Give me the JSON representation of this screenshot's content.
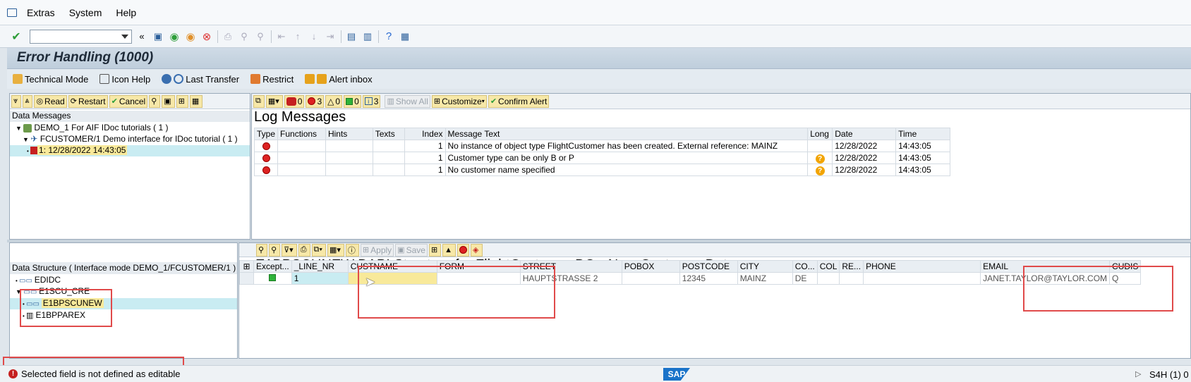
{
  "menu": {
    "items": [
      "Extras",
      "System",
      "Help"
    ]
  },
  "title": "Error Handling (1000)",
  "app_toolbar": [
    "Technical Mode",
    "Icon Help",
    "Last Transfer",
    "Restrict",
    "Alert inbox"
  ],
  "left_pane": {
    "buttons": [
      "Read",
      "Restart",
      "Cancel"
    ],
    "section_title": "Data Messages",
    "tree": [
      "DEMO_1 For AIF IDoc tutorials ( 1 )",
      "FCUSTOMER/1 Demo interface for IDoc tutorial ( 1 )",
      "1: 12/28/2022 14:43:05"
    ]
  },
  "log": {
    "counts": {
      "stop": "0",
      "error": "3",
      "warning": "0",
      "success": "0",
      "info": "3"
    },
    "buttons": [
      "Show All",
      "Customize",
      "Confirm Alert"
    ],
    "title": "Log Messages",
    "columns": [
      "Type",
      "Functions",
      "Hints",
      "Texts",
      "Index",
      "Message Text",
      "Long",
      "Date",
      "Time"
    ],
    "rows": [
      {
        "index": "1",
        "text": "No instance of object type FlightCustomer has been created. External reference: MAINZ",
        "long": "",
        "date": "12/28/2022",
        "time": "14:43:05"
      },
      {
        "index": "1",
        "text": "Customer type can be only B or P",
        "long": "?",
        "date": "12/28/2022",
        "time": "14:43:05"
      },
      {
        "index": "1",
        "text": "No customer name specified",
        "long": "?",
        "date": "12/28/2022",
        "time": "14:43:05"
      }
    ]
  },
  "struct": {
    "title": "Data Structure ( Interface mode DEMO_1/FCUSTOMER/1 )",
    "tree": [
      "EDIDC",
      "E1SCU_CRE",
      "E1BPSCUNEW",
      "E1BPPAREX"
    ]
  },
  "detail": {
    "buttons": [
      "Apply",
      "Save"
    ],
    "title": "E1BPSCUNEW:BAPI Structure for FlightCustomer BO - New Customer Data",
    "columns": [
      "Except...",
      "_LINE_NR",
      "CUSTNAME",
      "FORM",
      "STREET",
      "POBOX",
      "POSTCODE",
      "CITY",
      "CO...",
      "COL",
      "RE...",
      "PHONE",
      "EMAIL",
      "CUDIS"
    ],
    "row": {
      "line_nr": "1",
      "custname": "",
      "form": "",
      "street": "HAUPTSTRASSE 2",
      "pobox": "",
      "postcode": "12345",
      "city": "MAINZ",
      "country": "DE",
      "col": "",
      "re": "",
      "phone": "",
      "email": "JANET.TAYLOR@TAYLOR.COM",
      "cudis": "Q"
    }
  },
  "status": {
    "message": "Selected field is not defined as editable",
    "system": "S4H (1) 0"
  },
  "colors": {
    "highlight": "#e04a4a",
    "selection": "#c9ecf2",
    "input": "#f8e99a"
  }
}
